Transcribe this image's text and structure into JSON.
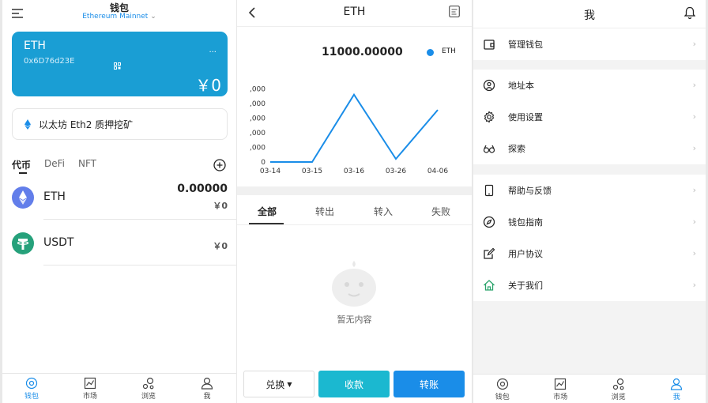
{
  "wallet": {
    "title": "钱包",
    "network": "Ethereum Mainnet",
    "card": {
      "name": "ETH",
      "address": "0x6D76d23E",
      "more": "...",
      "balance": "￥0"
    },
    "staking": "以太坊 Eth2 质押挖矿",
    "tabs": [
      "代币",
      "DeFi",
      "NFT"
    ],
    "tokens": [
      {
        "name": "ETH",
        "balance": "0.00000",
        "fiat": "￥0"
      },
      {
        "name": "USDT",
        "balance": "",
        "fiat": "￥0"
      }
    ]
  },
  "detail": {
    "title": "ETH",
    "amount": "11000.00000",
    "legend": "ETH",
    "filter_tabs": [
      "全部",
      "转出",
      "转入",
      "失败"
    ],
    "empty_text": "暂无内容",
    "actions": {
      "exchange": "兑换",
      "receive": "收款",
      "send": "转账"
    }
  },
  "chart_data": {
    "type": "line",
    "categories": [
      "03-14",
      "03-15",
      "03-16",
      "03-26",
      "04-06"
    ],
    "series": [
      {
        "name": "ETH",
        "values": [
          0,
          0,
          11000,
          500,
          8500
        ]
      }
    ],
    "y_ticks": [
      "0",
      ",000",
      ",000",
      ",000",
      ",000",
      ",000"
    ],
    "ylim": [
      0,
      12000
    ],
    "color": "#1a8de8",
    "grid": false,
    "legend_position": "top-right"
  },
  "me": {
    "title": "我",
    "menu": [
      {
        "label": "管理钱包",
        "icon": "wallet-icon"
      },
      {
        "label": "地址本",
        "icon": "contact-icon"
      },
      {
        "label": "使用设置",
        "icon": "gear-icon"
      },
      {
        "label": "探索",
        "icon": "explore-icon"
      },
      {
        "label": "帮助与反馈",
        "icon": "phone-icon"
      },
      {
        "label": "钱包指南",
        "icon": "compass-icon"
      },
      {
        "label": "用户协议",
        "icon": "edit-icon"
      },
      {
        "label": "关于我们",
        "icon": "home-icon"
      }
    ]
  },
  "tabbar": [
    "钱包",
    "市场",
    "浏览",
    "我"
  ],
  "colors": {
    "accent": "#1a8de8",
    "card": "#1a9ed4",
    "receive": "#1bb8d0",
    "send": "#1a8de8"
  }
}
